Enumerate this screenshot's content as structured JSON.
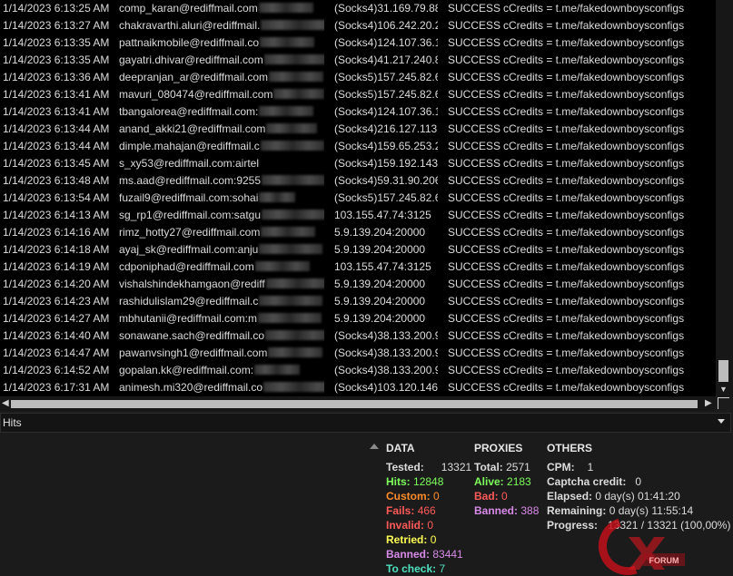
{
  "log": {
    "rows": [
      {
        "time": "1/14/2023 6:13:25 AM",
        "account": "comp_karan@rediffmail.com",
        "proxy": "(Socks4)31.169.79.88:",
        "status": "SUCCESS",
        "capture": "cCredits = t.me/fakedownboysconfigs"
      },
      {
        "time": "1/14/2023 6:13:27 AM",
        "account": "chakravarthi.aluri@rediffmail.",
        "proxy": "(Socks4)106.242.20.21",
        "status": "SUCCESS",
        "capture": "cCredits = t.me/fakedownboysconfigs"
      },
      {
        "time": "1/14/2023 6:13:35 AM",
        "account": "pattnaikmobile@rediffmail.co",
        "proxy": "(Socks4)124.107.36.1",
        "status": "SUCCESS",
        "capture": "cCredits = t.me/fakedownboysconfigs"
      },
      {
        "time": "1/14/2023 6:13:35 AM",
        "account": "gayatri.dhivar@rediffmail.com",
        "proxy": "(Socks4)41.217.240.8",
        "status": "SUCCESS",
        "capture": "cCredits = t.me/fakedownboysconfigs"
      },
      {
        "time": "1/14/2023 6:13:36 AM",
        "account": "deepranjan_ar@rediffmail.com",
        "proxy": "(Socks5)157.245.82.62",
        "status": "SUCCESS",
        "capture": "cCredits = t.me/fakedownboysconfigs"
      },
      {
        "time": "1/14/2023 6:13:41 AM",
        "account": "mavuri_080474@rediffmail.com",
        "proxy": "(Socks5)157.245.82.62",
        "status": "SUCCESS",
        "capture": "cCredits = t.me/fakedownboysconfigs"
      },
      {
        "time": "1/14/2023 6:13:41 AM",
        "account": "tbangalorea@rediffmail.com:",
        "proxy": "(Socks4)124.107.36.1",
        "status": "SUCCESS",
        "capture": "cCredits = t.me/fakedownboysconfigs"
      },
      {
        "time": "1/14/2023 6:13:44 AM",
        "account": "anand_akki21@rediffmail.com",
        "proxy": "(Socks4)216.127.113.5",
        "status": "SUCCESS",
        "capture": "cCredits = t.me/fakedownboysconfigs"
      },
      {
        "time": "1/14/2023 6:13:44 AM",
        "account": "dimple.mahajan@rediffmail.c",
        "proxy": "(Socks4)159.65.253.2",
        "status": "SUCCESS",
        "capture": "cCredits = t.me/fakedownboysconfigs"
      },
      {
        "time": "1/14/2023 6:13:45 AM",
        "account": "s_xy53@rediffmail.com:airtel",
        "proxy": "(Socks4)159.192.143.2",
        "status": "SUCCESS",
        "capture": "cCredits = t.me/fakedownboysconfigs"
      },
      {
        "time": "1/14/2023 6:13:48 AM",
        "account": "ms.aad@rediffmail.com:9255",
        "proxy": "(Socks4)59.31.90.206",
        "status": "SUCCESS",
        "capture": "cCredits = t.me/fakedownboysconfigs"
      },
      {
        "time": "1/14/2023 6:13:54 AM",
        "account": "fuzail9@rediffmail.com:sohai",
        "proxy": "(Socks5)157.245.82.62",
        "status": "SUCCESS",
        "capture": "cCredits = t.me/fakedownboysconfigs"
      },
      {
        "time": "1/14/2023 6:14:13 AM",
        "account": "sg_rp1@rediffmail.com:satgu",
        "proxy": "103.155.47.74:3125",
        "status": "SUCCESS",
        "capture": "cCredits = t.me/fakedownboysconfigs"
      },
      {
        "time": "1/14/2023 6:14:16 AM",
        "account": "rimz_hotty27@rediffmail.com",
        "proxy": "5.9.139.204:20000",
        "status": "SUCCESS",
        "capture": "cCredits = t.me/fakedownboysconfigs"
      },
      {
        "time": "1/14/2023 6:14:18 AM",
        "account": "ayaj_sk@rediffmail.com:anju",
        "proxy": "5.9.139.204:20000",
        "status": "SUCCESS",
        "capture": "cCredits = t.me/fakedownboysconfigs"
      },
      {
        "time": "1/14/2023 6:14:19 AM",
        "account": "cdponiphad@rediffmail.com",
        "proxy": "103.155.47.74:3125",
        "status": "SUCCESS",
        "capture": "cCredits = t.me/fakedownboysconfigs"
      },
      {
        "time": "1/14/2023 6:14:20 AM",
        "account": "vishalshindekhamgaon@rediff",
        "proxy": "5.9.139.204:20000",
        "status": "SUCCESS",
        "capture": "cCredits = t.me/fakedownboysconfigs"
      },
      {
        "time": "1/14/2023 6:14:23 AM",
        "account": "rashidulislam29@rediffmail.c",
        "proxy": "5.9.139.204:20000",
        "status": "SUCCESS",
        "capture": "cCredits = t.me/fakedownboysconfigs"
      },
      {
        "time": "1/14/2023 6:14:27 AM",
        "account": "mbhutanii@rediffmail.com:m",
        "proxy": "5.9.139.204:20000",
        "status": "SUCCESS",
        "capture": "cCredits = t.me/fakedownboysconfigs"
      },
      {
        "time": "1/14/2023 6:14:40 AM",
        "account": "sonawane.sach@rediffmail.co",
        "proxy": "(Socks4)38.133.200.94",
        "status": "SUCCESS",
        "capture": "cCredits = t.me/fakedownboysconfigs"
      },
      {
        "time": "1/14/2023 6:14:47 AM",
        "account": "pawanvsingh1@rediffmail.com",
        "proxy": "(Socks4)38.133.200.94",
        "status": "SUCCESS",
        "capture": "cCredits = t.me/fakedownboysconfigs"
      },
      {
        "time": "1/14/2023 6:14:52 AM",
        "account": "gopalan.kk@rediffmail.com:",
        "proxy": "(Socks4)38.133.200.94",
        "status": "SUCCESS",
        "capture": "cCredits = t.me/fakedownboysconfigs"
      },
      {
        "time": "1/14/2023 6:17:31 AM",
        "account": "animesh.mi320@rediffmail.co",
        "proxy": "(Socks4)103.120.146.3",
        "status": "SUCCESS",
        "capture": "cCredits = t.me/fakedownboysconfigs"
      }
    ]
  },
  "dropdown": {
    "selected": "Hits"
  },
  "stats": {
    "data": {
      "header": "DATA",
      "tested": {
        "label": "Tested:",
        "value": "13321"
      },
      "hits": {
        "label": "Hits:",
        "value": "12848"
      },
      "custom": {
        "label": "Custom:",
        "value": "0"
      },
      "fails": {
        "label": "Fails:",
        "value": "466"
      },
      "invalid": {
        "label": "Invalid:",
        "value": "0"
      },
      "retried": {
        "label": "Retried:",
        "value": "0"
      },
      "banned": {
        "label": "Banned:",
        "value": "83441"
      },
      "tocheck": {
        "label": "To check:",
        "value": "7"
      }
    },
    "proxies": {
      "header": "PROXIES",
      "total": {
        "label": "Total:",
        "value": "2571"
      },
      "alive": {
        "label": "Alive:",
        "value": "2183"
      },
      "bad": {
        "label": "Bad:",
        "value": "0"
      },
      "banned": {
        "label": "Banned:",
        "value": "388"
      }
    },
    "others": {
      "header": "OTHERS",
      "cpm": {
        "label": "CPM:",
        "value": "1"
      },
      "captcha": {
        "label": "Captcha credit:",
        "value": "0"
      },
      "elapsed": {
        "label": "Elapsed:",
        "value": "0 day(s) 01:41:20"
      },
      "remaining": {
        "label": "Remaining:",
        "value": "0 day(s) 11:55:14"
      },
      "progress": {
        "label": "Progress:",
        "value": "13321 / 13321 (100,00%)"
      }
    }
  },
  "watermark": {
    "text": "FORUM"
  },
  "colors": {
    "text": "#dcdcdc",
    "hits": "#7cfc5a",
    "custom": "#ff8c2a",
    "fails": "#ff5a5a",
    "retried": "#ffff55",
    "banned": "#d88ae8",
    "tocheck": "#4fe0c0",
    "watermark": "#c0101a"
  }
}
